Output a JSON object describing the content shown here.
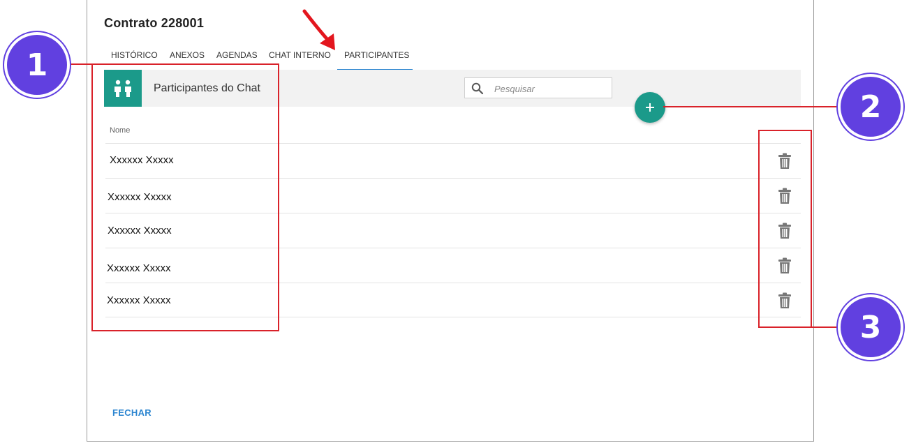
{
  "dialog": {
    "title": "Contrato 228001",
    "close_label": "FECHAR"
  },
  "tabs": [
    {
      "label": "HISTÓRICO",
      "active": false
    },
    {
      "label": "ANEXOS",
      "active": false
    },
    {
      "label": "AGENDAS",
      "active": false
    },
    {
      "label": "CHAT INTERNO",
      "active": false
    },
    {
      "label": "PARTICIPANTES",
      "active": true
    }
  ],
  "participants": {
    "header_title": "Participantes do Chat",
    "header_icon": "people-exchange-icon",
    "search": {
      "placeholder": "Pesquisar",
      "value": ""
    },
    "add_button": {
      "icon": "plus-icon"
    },
    "column_header": "Nome",
    "rows": [
      {
        "name": "Xxxxxx Xxxxx"
      },
      {
        "name": "Xxxxxx Xxxxx"
      },
      {
        "name": "Xxxxxx Xxxxx"
      },
      {
        "name": "Xxxxxx Xxxxx"
      },
      {
        "name": "Xxxxxx Xxxxx"
      }
    ],
    "row_action_icon": "trash-icon"
  },
  "annotations": {
    "callouts": [
      "1",
      "2",
      "3"
    ],
    "arrow": "red-arrow-icon"
  },
  "colors": {
    "teal": "#1b9a8a",
    "tab_underline": "#2b85d0",
    "annotation_red": "#d9222a",
    "callout_purple": "#6140e0"
  }
}
